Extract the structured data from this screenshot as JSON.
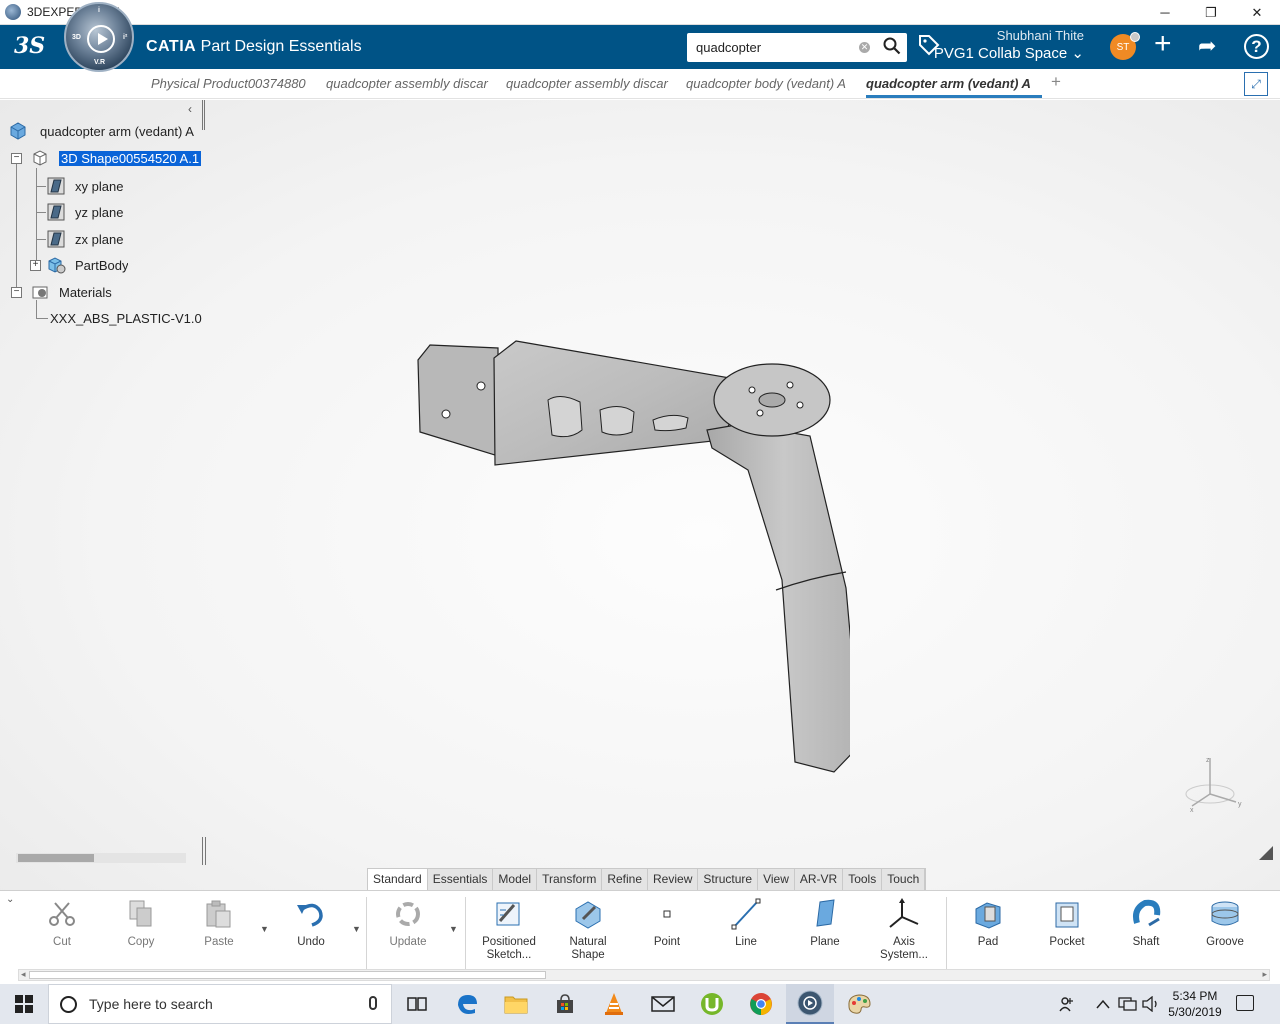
{
  "window": {
    "title": "3DEXPERIENCE",
    "controls": [
      "─",
      "❐",
      "✕"
    ]
  },
  "header": {
    "logo": "3S",
    "compass_labels": {
      "top": "i",
      "left": "3D",
      "right": "i²",
      "bottom": "V.R"
    },
    "brand_bold": "CATIA",
    "brand_rest": " Part Design Essentials",
    "search_value": "quadcopter",
    "user_name": "Shubhani Thite",
    "collab_space": "PVG1 Collab Space",
    "collab_chevron": "⌄",
    "avatar_initials": "ST",
    "plus_glyph": "+",
    "share_glyph": "➦",
    "help_glyph": "?"
  },
  "tabs": [
    {
      "label": "Physical Product00374880"
    },
    {
      "label": "quadcopter assembly discar"
    },
    {
      "label": "quadcopter assembly discar"
    },
    {
      "label": "quadcopter body (vedant) A"
    },
    {
      "label": "quadcopter arm (vedant) A"
    }
  ],
  "tab_add": "+",
  "tree": {
    "collapse_glyph": "‹",
    "root": "quadcopter arm (vedant) A",
    "shape": "3D Shape00554520 A.1",
    "planes": [
      "xy plane",
      "yz plane",
      "zx plane"
    ],
    "partbody": "PartBody",
    "materials": "Materials",
    "material_item": "XXX_ABS_PLASTIC-V1.0 (",
    "expand_minus": "−",
    "expand_plus": "+"
  },
  "section_tabs": [
    "Standard",
    "Essentials",
    "Model",
    "Transform",
    "Refine",
    "Review",
    "Structure",
    "View",
    "AR-VR",
    "Tools",
    "Touch"
  ],
  "commands": {
    "cut": "Cut",
    "copy": "Copy",
    "paste": "Paste",
    "undo": "Undo",
    "update": "Update",
    "positioned_sketch": [
      "Positioned",
      "Sketch..."
    ],
    "natural_shape": [
      "Natural",
      "Shape"
    ],
    "point": "Point",
    "line": "Line",
    "plane": "Plane",
    "axis_system": [
      "Axis",
      "System..."
    ],
    "pad": "Pad",
    "pocket": "Pocket",
    "shaft": "Shaft",
    "groove": "Groove"
  },
  "triad_labels": {
    "z": "z",
    "x": "x",
    "y": "y"
  },
  "taskbar": {
    "search_placeholder": "Type here to search",
    "time": "5:34 PM",
    "date": "5/30/2019"
  },
  "colors": {
    "header_bg": "#005386",
    "selection": "#0a64d8",
    "active_tab_underline": "#2a7dbd",
    "avatar": "#f08a24"
  }
}
